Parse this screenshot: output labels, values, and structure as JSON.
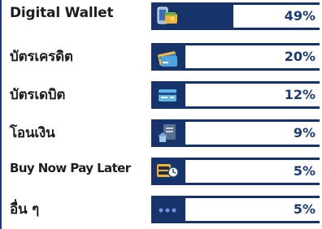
{
  "chart_data": {
    "type": "bar",
    "orientation": "horizontal",
    "categories": [
      "Digital Wallet",
      "บัตรเครดิต",
      "บัตรเดบิต",
      "โอนเงิน",
      "Buy Now Pay Later",
      "อื่น ๆ"
    ],
    "values": [
      49,
      20,
      12,
      9,
      5,
      5
    ],
    "value_labels": [
      "49%",
      "20%",
      "12%",
      "9%",
      "5%",
      "5%"
    ],
    "icons": [
      "wallet-phone-icon",
      "credit-card-icon",
      "debit-card-icon",
      "bank-transfer-icon",
      "bnpl-clock-icon",
      "more-dots-icon"
    ],
    "xlim": [
      0,
      100
    ],
    "colors": {
      "bar": "#16336a",
      "track": "#ffffff",
      "value_text": "#1c3a73",
      "label_text": "#1d1d1d"
    }
  }
}
